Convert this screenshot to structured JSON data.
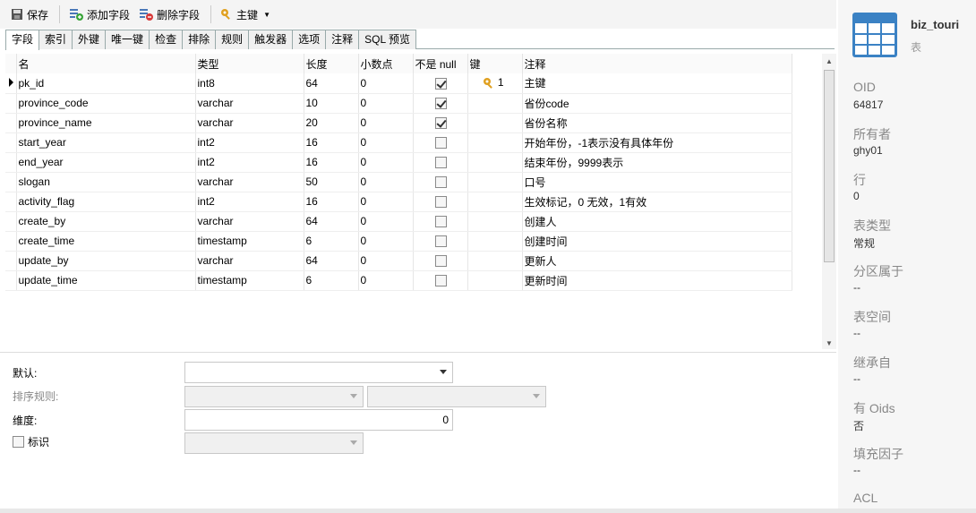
{
  "toolbar": {
    "save_label": "保存",
    "add_field_label": "添加字段",
    "delete_field_label": "删除字段",
    "primary_key_label": "主键"
  },
  "tabs": [
    "字段",
    "索引",
    "外键",
    "唯一键",
    "检查",
    "排除",
    "规则",
    "触发器",
    "选项",
    "注释",
    "SQL 预览"
  ],
  "grid": {
    "headers": [
      "名",
      "类型",
      "长度",
      "小数点",
      "不是 null",
      "键",
      "注释"
    ],
    "rows": [
      {
        "name": "pk_id",
        "type": "int8",
        "length": "64",
        "decimal": "0",
        "not_null": true,
        "key": "1",
        "comment": "主键"
      },
      {
        "name": "province_code",
        "type": "varchar",
        "length": "10",
        "decimal": "0",
        "not_null": true,
        "key": "",
        "comment": "省份code"
      },
      {
        "name": "province_name",
        "type": "varchar",
        "length": "20",
        "decimal": "0",
        "not_null": true,
        "key": "",
        "comment": "省份名称"
      },
      {
        "name": "start_year",
        "type": "int2",
        "length": "16",
        "decimal": "0",
        "not_null": false,
        "key": "",
        "comment": "开始年份，-1表示没有具体年份"
      },
      {
        "name": "end_year",
        "type": "int2",
        "length": "16",
        "decimal": "0",
        "not_null": false,
        "key": "",
        "comment": "结束年份，9999表示"
      },
      {
        "name": "slogan",
        "type": "varchar",
        "length": "50",
        "decimal": "0",
        "not_null": false,
        "key": "",
        "comment": "口号"
      },
      {
        "name": "activity_flag",
        "type": "int2",
        "length": "16",
        "decimal": "0",
        "not_null": false,
        "key": "",
        "comment": "生效标记，0 无效，1有效"
      },
      {
        "name": "create_by",
        "type": "varchar",
        "length": "64",
        "decimal": "0",
        "not_null": false,
        "key": "",
        "comment": "创建人"
      },
      {
        "name": "create_time",
        "type": "timestamp",
        "length": "6",
        "decimal": "0",
        "not_null": false,
        "key": "",
        "comment": "创建时间"
      },
      {
        "name": "update_by",
        "type": "varchar",
        "length": "64",
        "decimal": "0",
        "not_null": false,
        "key": "",
        "comment": "更新人"
      },
      {
        "name": "update_time",
        "type": "timestamp",
        "length": "6",
        "decimal": "0",
        "not_null": false,
        "key": "",
        "comment": "更新时间"
      }
    ]
  },
  "props": {
    "default_label": "默认:",
    "collation_label": "排序规则:",
    "dimension_label": "维度:",
    "dimension_value": "0",
    "identity_label": "标识"
  },
  "info": {
    "name": "biz_touri",
    "type": "表",
    "items": [
      {
        "k": "OID",
        "v": "64817"
      },
      {
        "k": "所有者",
        "v": "ghy01"
      },
      {
        "k": "行",
        "v": "0"
      },
      {
        "k": "表类型",
        "v": "常规"
      },
      {
        "k": "分区属于",
        "v": "--"
      },
      {
        "k": "表空间",
        "v": "--"
      },
      {
        "k": "继承自",
        "v": "--"
      },
      {
        "k": "有 Oids",
        "v": "否"
      },
      {
        "k": "填充因子",
        "v": "--"
      },
      {
        "k": "ACL",
        "v": ""
      }
    ]
  },
  "colors": {
    "key_icon": "#e0a020",
    "table_icon": "#3b82c4"
  }
}
